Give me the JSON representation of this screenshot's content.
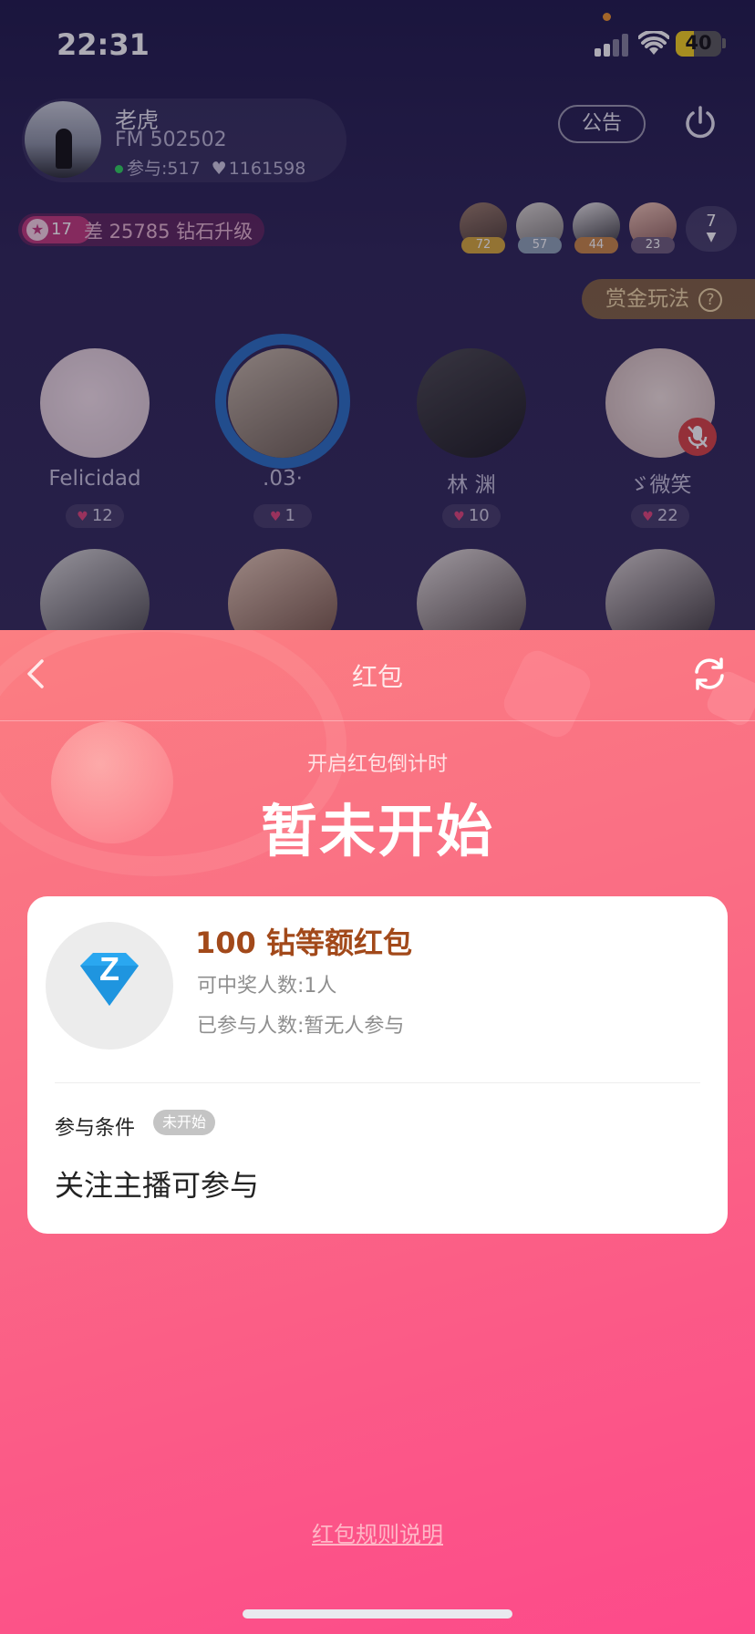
{
  "status_bar": {
    "time": "22:31",
    "battery": "40",
    "battery_level": 0.4
  },
  "host": {
    "name": "老虎",
    "fm": "FM 502502",
    "participants": "参与:517",
    "likes": "1161598"
  },
  "header_actions": {
    "notice": "公告"
  },
  "level": {
    "badge": "17",
    "text": "差 25785 钻石升级"
  },
  "viewers": {
    "items": [
      {
        "count": "72",
        "color": "#d8a93a"
      },
      {
        "count": "57",
        "color": "#8fa4b5"
      },
      {
        "count": "44",
        "color": "#c98745"
      },
      {
        "count": "23",
        "color": "#6f5f7c"
      }
    ],
    "more_count": "7"
  },
  "bounty": {
    "label": "赏金玩法",
    "help": "?"
  },
  "seats": [
    {
      "name": "Felicidad",
      "likes": "12",
      "speaking": false,
      "muted": false
    },
    {
      "name": ".03·",
      "likes": "1",
      "speaking": true,
      "muted": false
    },
    {
      "name": "林  渊",
      "likes": "10",
      "speaking": false,
      "muted": false
    },
    {
      "name": "ゞ微笑",
      "likes": "22",
      "speaking": false,
      "muted": true
    }
  ],
  "red_packet": {
    "title": "红包",
    "countdown_label": "开启红包倒计时",
    "status": "暂未开始",
    "prize": {
      "title": "100 钻等额红包",
      "icon_letter": "Z",
      "winners": "可中奖人数:1人",
      "joined": "已参与人数:暂无人参与"
    },
    "condition": {
      "label": "参与条件",
      "badge": "未开始",
      "text": "关注主播可参与"
    },
    "rules_link": "红包规则说明"
  },
  "colors": {
    "sheet_gradient_start": "#fb7e82",
    "sheet_gradient_end": "#fd4a8a",
    "prize_title": "#a2491a",
    "diamond": "#2aa7f0"
  }
}
